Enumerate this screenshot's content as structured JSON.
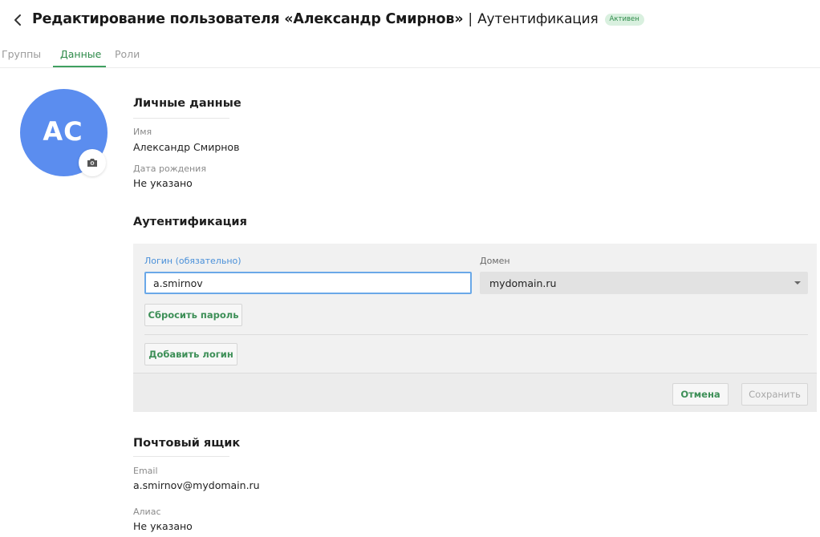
{
  "header": {
    "back_glyph": "‹",
    "title_main": "Редактирование пользователя «Александр Смирнов»",
    "title_sep": "|",
    "title_sub": "Аутентификация",
    "badge": "Активен"
  },
  "tabs": [
    {
      "label": "Группы",
      "active": false
    },
    {
      "label": "Данные",
      "active": true
    },
    {
      "label": "Роли",
      "active": false
    }
  ],
  "avatar": {
    "initials": "AC",
    "color": "#5b8def",
    "camera_icon": "camera-icon"
  },
  "personal": {
    "title": "Личные данные",
    "name_label": "Имя",
    "name_value": "Александр Смирнов",
    "birth_label": "Дата рождения",
    "birth_value": "Не указано"
  },
  "auth": {
    "title": "Аутентификация",
    "login_label": "Логин (обязательно)",
    "login_value": "a.smirnov",
    "domain_label": "Домен",
    "domain_value": "mydomain.ru",
    "reset_password": "Сбросить пароль",
    "add_login": "Добавить логин",
    "cancel": "Отмена",
    "save": "Сохранить"
  },
  "mailbox": {
    "title": "Почтовый ящик",
    "email_label": "Email",
    "email_value": "a.smirnov@mydomain.ru",
    "alias_label": "Алиас",
    "alias_value": "Не указано"
  },
  "colors": {
    "accent_green": "#2e8b4a",
    "input_focus": "#6aa8e8",
    "avatar_blue": "#5b8def"
  }
}
